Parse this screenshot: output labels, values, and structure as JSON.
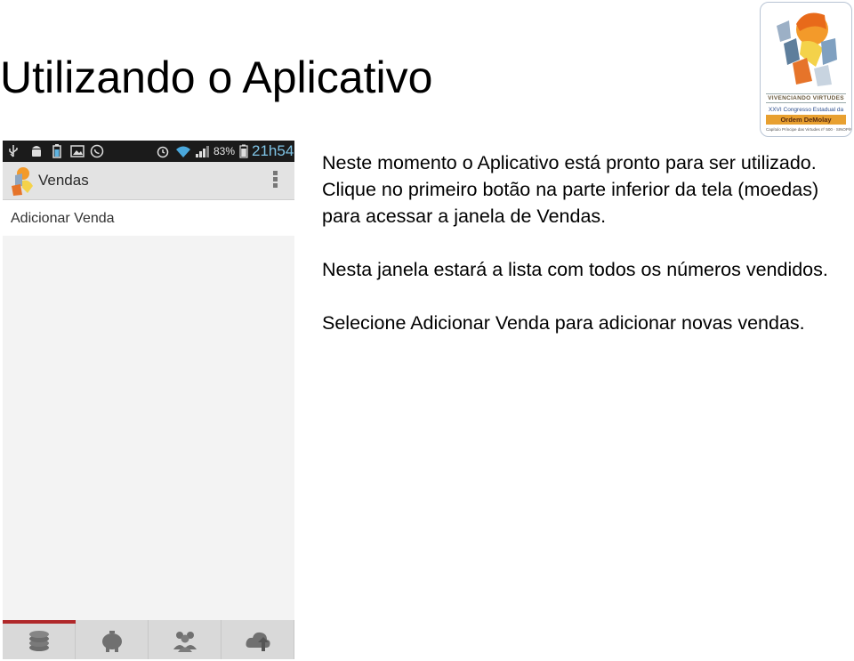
{
  "slide": {
    "title": "Utilizando o Aplicativo",
    "paragraphs": [
      "Neste momento o Aplicativo está pronto para ser utilizado. Clique no primeiro botão na parte inferior da tela (moedas) para acessar a janela de Vendas.",
      "Nesta janela estará a lista com todos os números vendidos.",
      "Selecione Adicionar Venda para adicionar novas vendas."
    ]
  },
  "logo": {
    "line1": "VIVENCIANDO VIRTUDES",
    "line2": "XXVI Congresso Estadual da",
    "line3": "Ordem DeMolay",
    "line4": "Capítulo Príncipe das Virtudes nº 500 · SINOP/MT"
  },
  "phone": {
    "status_bar": {
      "battery": "83%",
      "time": "21h54",
      "icons": [
        "usb-icon",
        "android-debug-icon",
        "battery-saver-icon",
        "image-icon",
        "whatsapp-icon",
        "alarm-icon",
        "wifi-icon",
        "signal-icon",
        "battery-icon"
      ]
    },
    "action_bar": {
      "title": "Vendas",
      "menu_icon": "overflow-menu-icon"
    },
    "add_sale_label": "Adicionar Venda",
    "bottom_nav": {
      "tabs": [
        {
          "icon": "coins-icon",
          "active": true
        },
        {
          "icon": "piggy-bank-icon",
          "active": false
        },
        {
          "icon": "people-icon",
          "active": false
        },
        {
          "icon": "cloud-upload-icon",
          "active": false
        }
      ],
      "active_color": "#b0282a"
    }
  }
}
